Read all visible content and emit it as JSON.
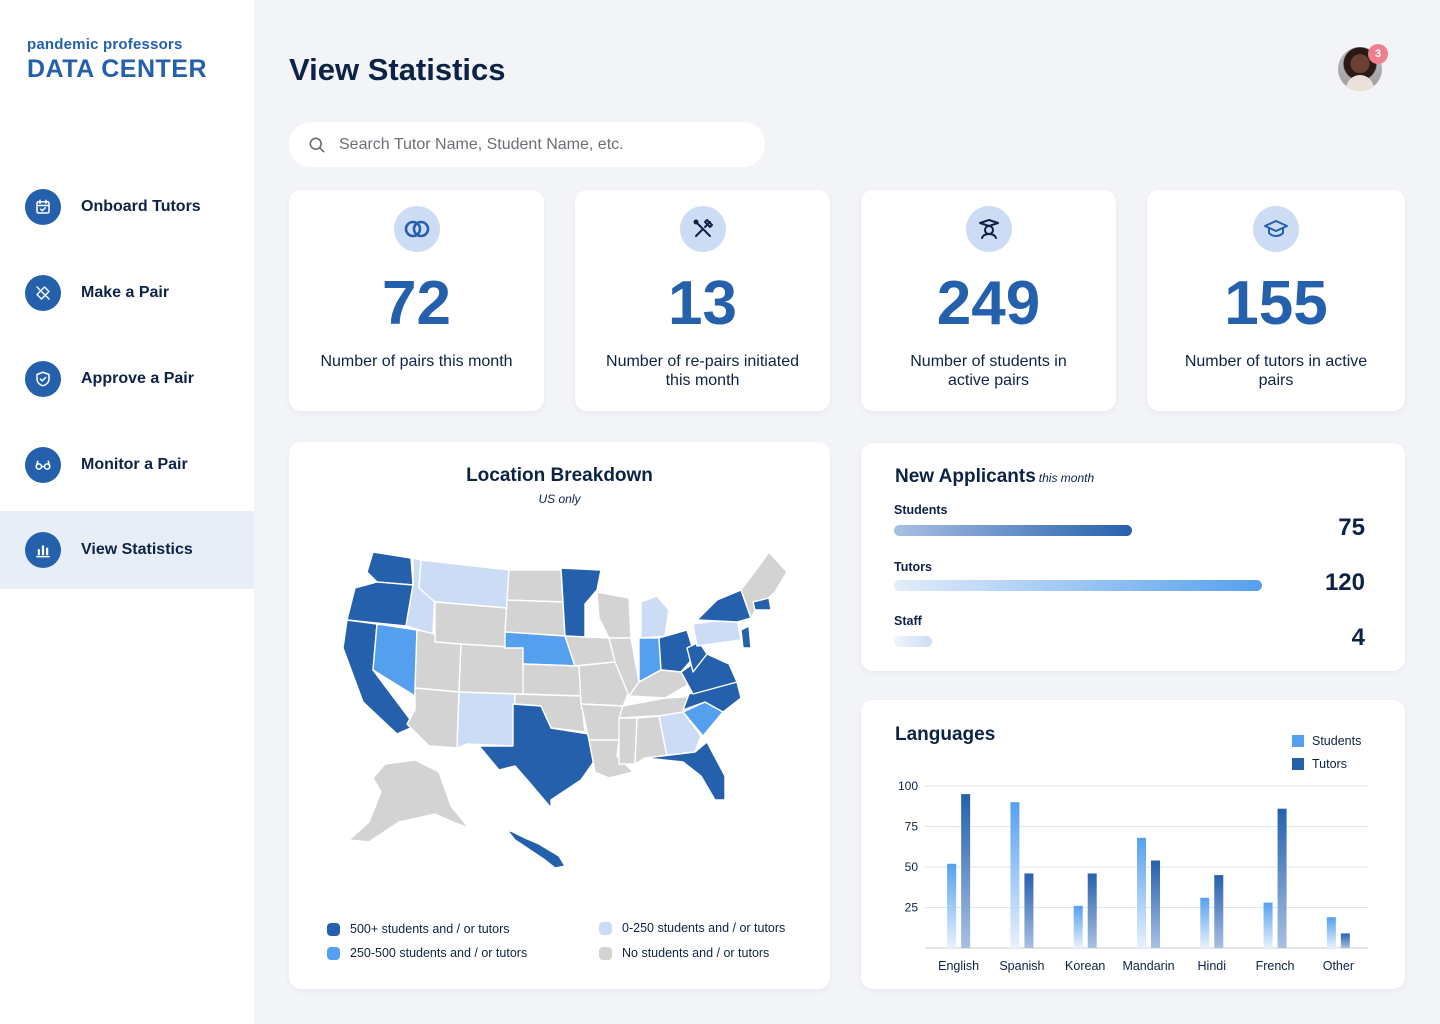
{
  "brand": {
    "small": "pandemic professors",
    "big": "DATA CENTER"
  },
  "nav": {
    "items": [
      {
        "label": "Onboard Tutors",
        "icon": "calendar-check-icon"
      },
      {
        "label": "Make a Pair",
        "icon": "tools-icon"
      },
      {
        "label": "Approve a Pair",
        "icon": "shield-check-icon"
      },
      {
        "label": "Monitor a Pair",
        "icon": "glasses-icon"
      },
      {
        "label": "View Statistics",
        "icon": "bar-chart-icon",
        "active": true
      }
    ]
  },
  "header": {
    "title": "View Statistics",
    "notification_count": "3"
  },
  "search": {
    "placeholder": "Search Tutor Name, Student Name, etc."
  },
  "stats": [
    {
      "value": "72",
      "label": "Number of pairs this month",
      "icon": "rings-icon"
    },
    {
      "value": "13",
      "label": "Number of re-pairs initiated this month",
      "icon": "tools-icon"
    },
    {
      "value": "249",
      "label": "Number of students in active pairs",
      "icon": "student-icon"
    },
    {
      "value": "155",
      "label": "Number of tutors in active pairs",
      "icon": "graduation-cap-icon"
    }
  ],
  "map": {
    "title": "Location Breakdown",
    "subtitle": "US only",
    "legend": [
      {
        "label": "500+ students and / or tutors",
        "color": "#2560ad"
      },
      {
        "label": "250-500 students and / or tutors",
        "color": "#55a0ee"
      },
      {
        "label": "0-250 students and / or tutors",
        "color": "#cddcf5"
      },
      {
        "label": "No students and / or tutors",
        "color": "#d3d3d3"
      }
    ]
  },
  "applicants": {
    "title": "New Applicants",
    "title_suffix": "this month",
    "rows": [
      {
        "label": "Students",
        "value": "75"
      },
      {
        "label": "Tutors",
        "value": "120"
      },
      {
        "label": "Staff",
        "value": "4"
      }
    ]
  },
  "languages": {
    "title": "Languages",
    "legend": {
      "students": "Students",
      "tutors": "Tutors"
    }
  },
  "chart_data": {
    "type": "bar",
    "title": "Languages",
    "categories": [
      "English",
      "Spanish",
      "Korean",
      "Mandarin",
      "Hindi",
      "French",
      "Other"
    ],
    "series": [
      {
        "name": "Students",
        "values": [
          52,
          90,
          26,
          68,
          31,
          28,
          19
        ],
        "color": "#55a0ee"
      },
      {
        "name": "Tutors",
        "values": [
          95,
          46,
          46,
          54,
          45,
          86,
          9
        ],
        "color": "#2560ad"
      }
    ],
    "yticks": [
      25,
      50,
      75,
      100
    ],
    "ylim": [
      0,
      100
    ],
    "grid": true,
    "legend_position": "top-right"
  }
}
